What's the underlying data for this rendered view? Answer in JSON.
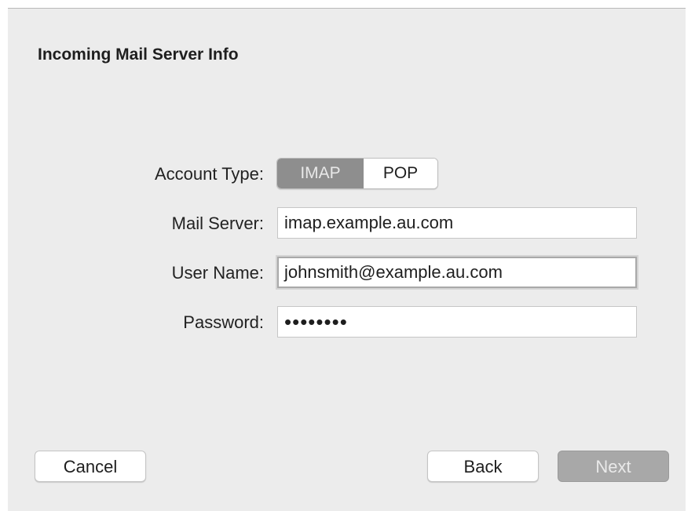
{
  "dialog": {
    "title": "Incoming Mail Server Info"
  },
  "form": {
    "account_type": {
      "label": "Account Type:",
      "options": [
        "IMAP",
        "POP"
      ],
      "selected": "IMAP"
    },
    "mail_server": {
      "label": "Mail Server:",
      "value": "imap.example.au.com"
    },
    "user_name": {
      "label": "User Name:",
      "value": "johnsmith@example.au.com"
    },
    "password": {
      "label": "Password:",
      "value": "••••••••"
    }
  },
  "buttons": {
    "cancel": "Cancel",
    "back": "Back",
    "next": "Next"
  },
  "colors": {
    "dialog_bg": "#ececec",
    "segment_selected": "#8e8e8e",
    "button_disabled": "#a8a8a8"
  }
}
